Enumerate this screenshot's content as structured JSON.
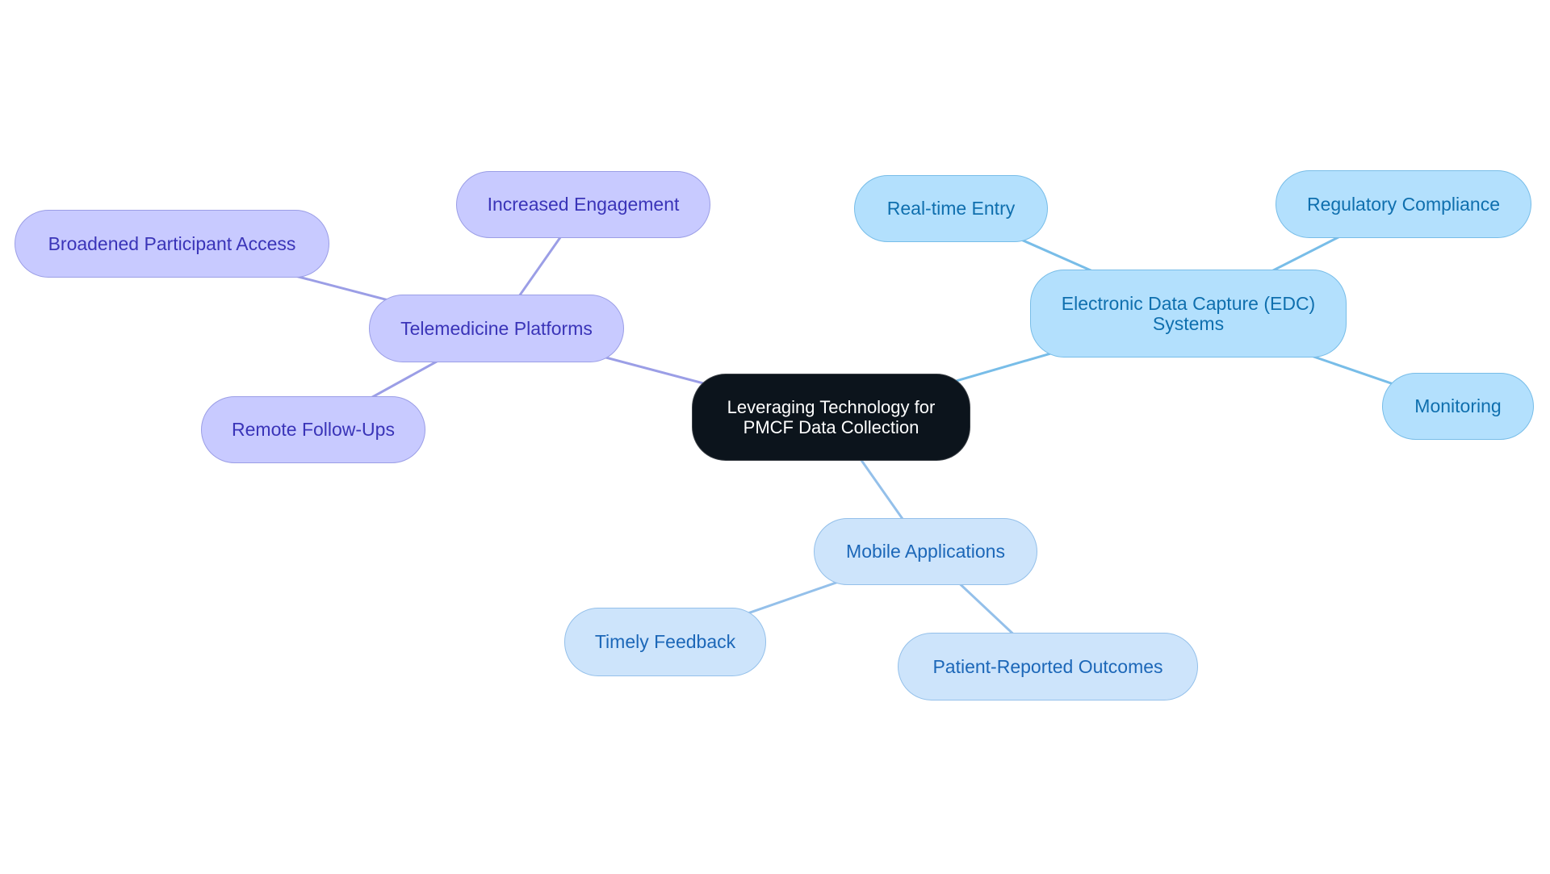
{
  "diagram": {
    "type": "mindmap",
    "root": {
      "id": "root",
      "label": "Leveraging Technology for\nPMCF Data Collection"
    },
    "branches": [
      {
        "id": "telemedicine",
        "label": "Telemedicine Platforms",
        "color_scheme": {
          "fill": "#c8caff",
          "stroke": "#9b9ee6",
          "text": "#3a34b8",
          "edge": "#9b9ee6"
        },
        "children": [
          {
            "id": "increased-engagement",
            "label": "Increased Engagement"
          },
          {
            "id": "broadened-access",
            "label": "Broadened Participant Access"
          },
          {
            "id": "remote-follow-ups",
            "label": "Remote Follow-Ups"
          }
        ]
      },
      {
        "id": "edc",
        "label": "Electronic Data Capture (EDC)\nSystems",
        "color_scheme": {
          "fill": "#b3e0fd",
          "stroke": "#78bde8",
          "text": "#0f6fae",
          "edge": "#78bde8"
        },
        "children": [
          {
            "id": "real-time-entry",
            "label": "Real-time Entry"
          },
          {
            "id": "regulatory-compliance",
            "label": "Regulatory Compliance"
          },
          {
            "id": "monitoring",
            "label": "Monitoring"
          }
        ]
      },
      {
        "id": "mobile",
        "label": "Mobile Applications",
        "color_scheme": {
          "fill": "#cde4fb",
          "stroke": "#94c0ea",
          "text": "#1c67b8",
          "edge": "#94c0ea"
        },
        "children": [
          {
            "id": "timely-feedback",
            "label": "Timely Feedback"
          },
          {
            "id": "patient-reported-outcomes",
            "label": "Patient-Reported Outcomes"
          }
        ]
      }
    ],
    "root_colors": {
      "fill": "#0c141c",
      "text": "#ffffff"
    }
  }
}
